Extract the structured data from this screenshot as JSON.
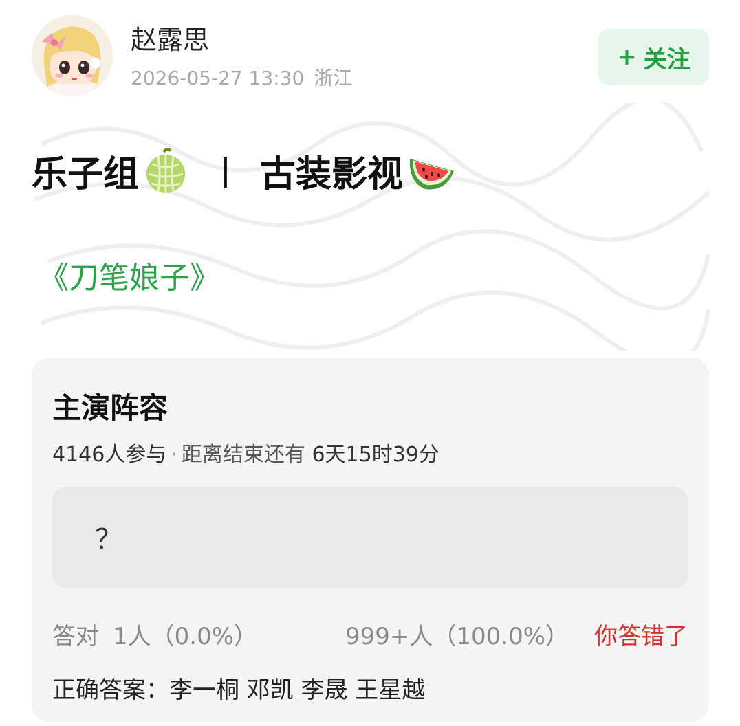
{
  "post": {
    "username": "赵露思",
    "timestamp": "2026-05-27 13:30",
    "location": "浙江",
    "follow_plus": "+",
    "follow_label": "关注",
    "title_left": "乐子组",
    "title_separator": "丨",
    "title_right": "古装影视",
    "drama_name": "《刀笔娘子》",
    "icons": {
      "avatar": "cartoon-girl-avatar",
      "melon": "melon-emoji",
      "watermelon": "watermelon-emoji"
    }
  },
  "poll": {
    "title": "主演阵容",
    "participants": "4146人参与",
    "separator": "·",
    "remaining_label": "距离结束还有",
    "remaining_time": "6天15时39分",
    "option_text": "？",
    "correct_label": "答对",
    "correct_count": "1人（0.0%）",
    "wrong_count": "999+人（100.0%）",
    "user_status": "你答错了",
    "answer_label": "正确答案：",
    "answer_value": "李一桐 邓凯 李晟 王星越"
  },
  "colors": {
    "accent_green": "#2aa34a",
    "follow_bg": "#e6f6ea",
    "wrong_red": "#d2342c",
    "card_bg": "#f4f4f4"
  }
}
